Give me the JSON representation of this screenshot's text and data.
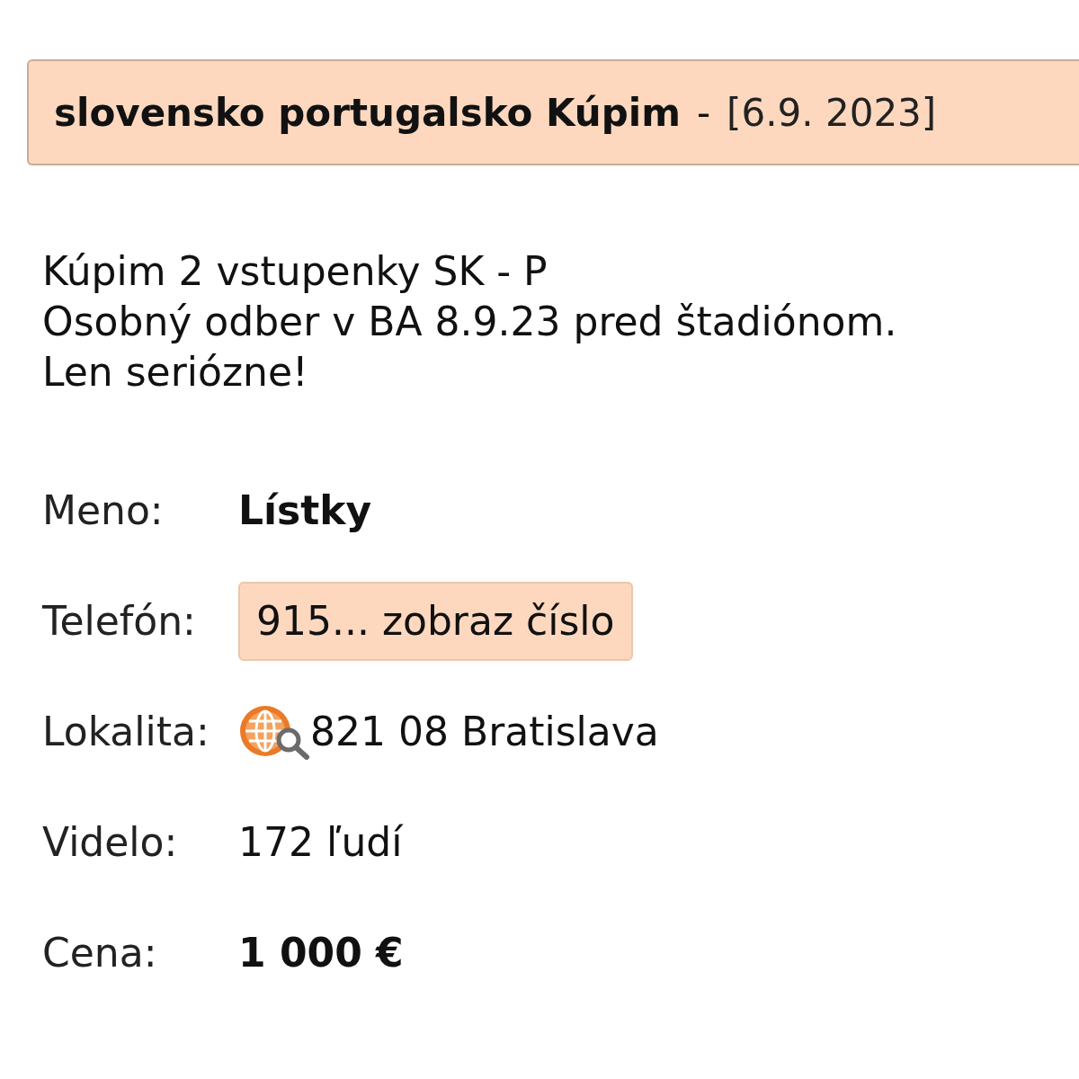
{
  "listing": {
    "title": "slovensko portugalsko Kúpim",
    "separator": "-",
    "date": "[6.9. 2023]"
  },
  "description": [
    "Kúpim 2 vstupenky SK - P",
    "Osobný odber v BA 8.9.23 pred štadiónom.",
    "Len seriózne!"
  ],
  "details": [
    {
      "kind": "strong",
      "label": "Meno:",
      "value": "Lístky"
    },
    {
      "kind": "button",
      "label": "Telefón:",
      "value": "915... zobraz číslo"
    },
    {
      "kind": "location",
      "label": "Lokalita:",
      "value": "821 08 Bratislava"
    },
    {
      "kind": "plain",
      "label": "Videlo:",
      "value": "172 ľudí"
    },
    {
      "kind": "strong",
      "label": "Cena:",
      "value": "1 000 €"
    }
  ]
}
